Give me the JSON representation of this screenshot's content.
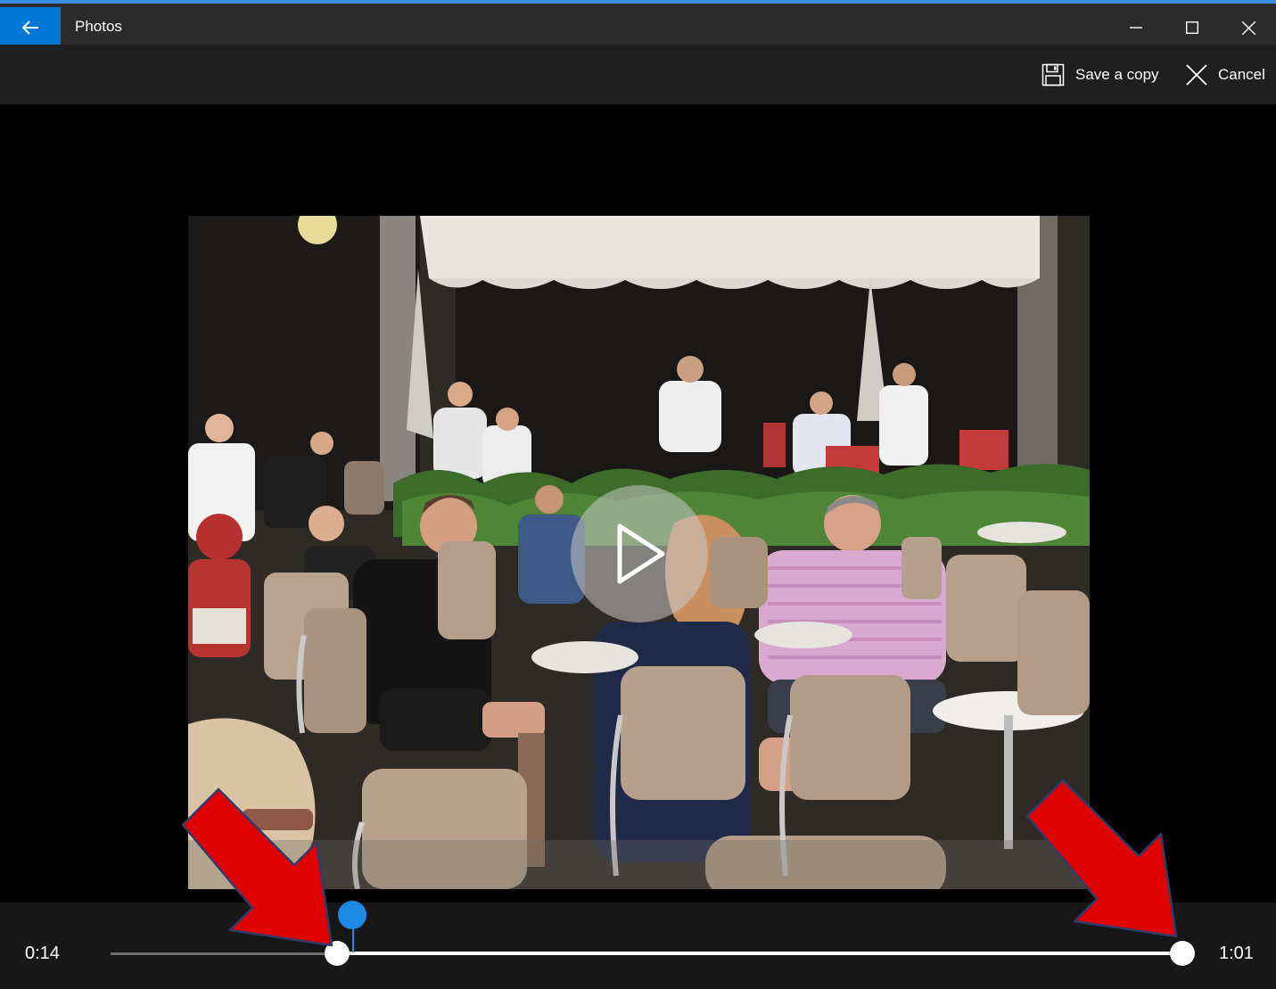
{
  "window": {
    "title": "Photos",
    "minimize_glyph": "—",
    "maximize_glyph": "☐",
    "close_glyph": "✕"
  },
  "toolbar": {
    "save_label": "Save a copy",
    "cancel_label": "Cancel",
    "save_icon": "save-copy-icon",
    "cancel_icon": "close-icon"
  },
  "player": {
    "play_icon": "play-icon"
  },
  "trim": {
    "start_time": "0:14",
    "end_time": "1:01"
  },
  "colors": {
    "accent": "#0078d7",
    "playhead": "#1e88e5",
    "annotation_arrow": "#e00000"
  }
}
